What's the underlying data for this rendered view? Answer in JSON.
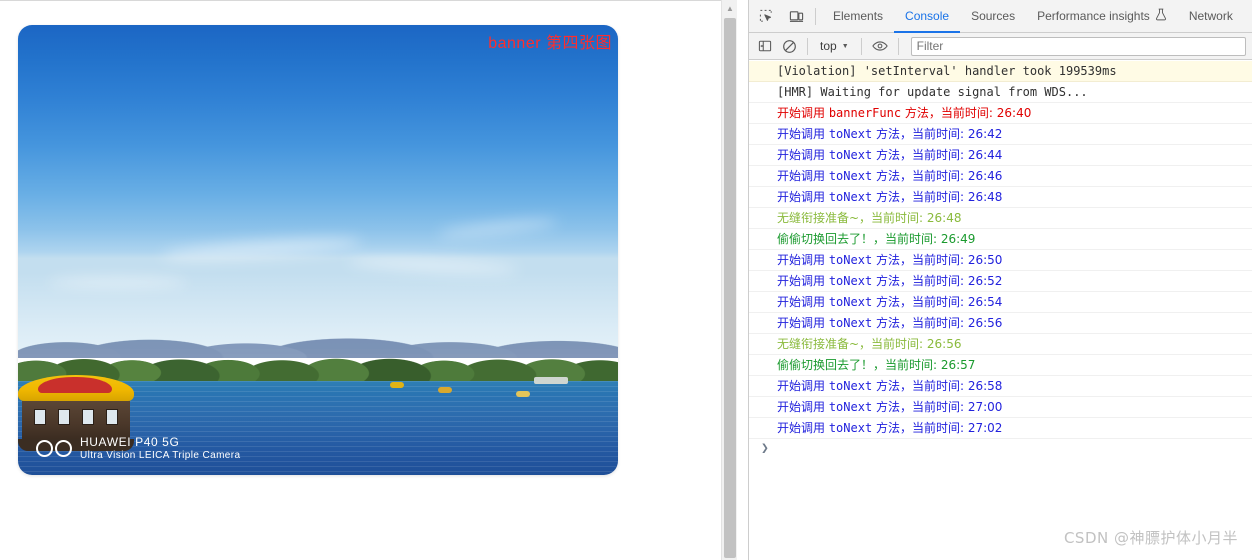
{
  "page": {
    "banner": {
      "label": "banner 第四张图",
      "label_color": "#ff2d2d",
      "camera_watermark_line1": "HUAWEI P40 5G",
      "camera_watermark_line2": "Ultra Vision LEICA Triple Camera"
    }
  },
  "devtools": {
    "icons": {
      "inspect": "inspect-element-icon",
      "device": "device-toolbar-icon"
    },
    "tabs": [
      {
        "label": "Elements",
        "active": false
      },
      {
        "label": "Console",
        "active": true
      },
      {
        "label": "Sources",
        "active": false
      },
      {
        "label": "Performance insights",
        "active": false,
        "badge_icon": "flask-icon"
      },
      {
        "label": "Network",
        "active": false
      }
    ],
    "toolbar": {
      "sidebar_toggle": "show-console-sidebar-icon",
      "clear_label": "clear-console-icon",
      "context": "top",
      "eye_label": "live-expression-icon",
      "filter_placeholder": "Filter",
      "filter_value": ""
    },
    "console_logs": [
      {
        "text": "[Violation] 'setInterval' handler took 199539ms",
        "style": "violation"
      },
      {
        "text": "[HMR] Waiting for update signal from WDS...",
        "style": "plain"
      },
      {
        "prefix": "开始调用 ",
        "mono": "bannerFunc",
        "suffix": " 方法，当前时间: 26:40",
        "style": "red"
      },
      {
        "prefix": "开始调用 ",
        "mono": "toNext",
        "suffix": " 方法，当前时间: 26:42",
        "style": "blue"
      },
      {
        "prefix": "开始调用 ",
        "mono": "toNext",
        "suffix": " 方法，当前时间: 26:44",
        "style": "blue"
      },
      {
        "prefix": "开始调用 ",
        "mono": "toNext",
        "suffix": " 方法，当前时间: 26:46",
        "style": "blue"
      },
      {
        "prefix": "开始调用 ",
        "mono": "toNext",
        "suffix": " 方法，当前时间: 26:48",
        "style": "blue"
      },
      {
        "text": "无缝衔接准备~，当前时间: 26:48",
        "style": "green-light"
      },
      {
        "text": "偷偷切换回去了！，当前时间: 26:49",
        "style": "green-dark"
      },
      {
        "prefix": "开始调用 ",
        "mono": "toNext",
        "suffix": " 方法，当前时间: 26:50",
        "style": "blue"
      },
      {
        "prefix": "开始调用 ",
        "mono": "toNext",
        "suffix": " 方法，当前时间: 26:52",
        "style": "blue"
      },
      {
        "prefix": "开始调用 ",
        "mono": "toNext",
        "suffix": " 方法，当前时间: 26:54",
        "style": "blue"
      },
      {
        "prefix": "开始调用 ",
        "mono": "toNext",
        "suffix": " 方法，当前时间: 26:56",
        "style": "blue"
      },
      {
        "text": "无缝衔接准备~，当前时间: 26:56",
        "style": "green-light"
      },
      {
        "text": "偷偷切换回去了！，当前时间: 26:57",
        "style": "green-dark"
      },
      {
        "prefix": "开始调用 ",
        "mono": "toNext",
        "suffix": " 方法，当前时间: 26:58",
        "style": "blue"
      },
      {
        "prefix": "开始调用 ",
        "mono": "toNext",
        "suffix": " 方法，当前时间: 27:00",
        "style": "blue"
      },
      {
        "prefix": "开始调用 ",
        "mono": "toNext",
        "suffix": " 方法，当前时间: 27:02",
        "style": "blue"
      }
    ],
    "prompt": "❯"
  },
  "watermark": "CSDN @神膘护体小月半"
}
